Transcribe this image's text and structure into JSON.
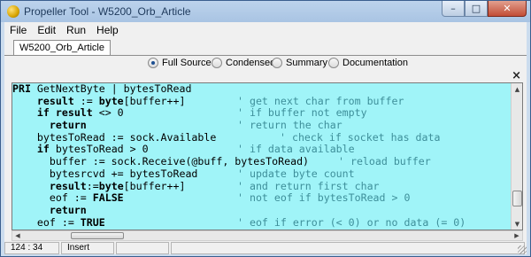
{
  "window": {
    "title": "Propeller Tool - W5200_Orb_Article",
    "minimize_glyph": "–",
    "maximize_glyph": "□",
    "close_glyph": "✕"
  },
  "menu": [
    "File",
    "Edit",
    "Run",
    "Help"
  ],
  "tabs": [
    {
      "label": "W5200_Orb_Article",
      "active": true
    }
  ],
  "view_options": {
    "full_source": "Full Source",
    "condensed": "Condensed",
    "summary": "Summary",
    "documentation": "Documentation",
    "selected": "Full Source"
  },
  "editor": {
    "background": "#a0f4f8",
    "comment_color": "#3e8f9a",
    "lines": [
      {
        "code": "PRI GetNextByte | bytesToRead",
        "comment": ""
      },
      {
        "code": "    result := byte[buffer++]",
        "comment": "' get next char from buffer"
      },
      {
        "code": "    if result <> 0",
        "comment": "' if buffer not empty"
      },
      {
        "code": "      return",
        "comment": "' return the char"
      },
      {
        "code": "    bytesToRead := sock.Available",
        "comment": "' check if socket has data"
      },
      {
        "code": "    if bytesToRead > 0",
        "comment": "' if data available"
      },
      {
        "code": "      buffer := sock.Receive(@buff, bytesToRead)",
        "comment": "' reload buffer"
      },
      {
        "code": "      bytesrcvd += bytesToRead",
        "comment": "' update byte count"
      },
      {
        "code": "      result:=byte[buffer++]",
        "comment": "' and return first char"
      },
      {
        "code": "      eof := FALSE",
        "comment": "' not eof if bytesToRead > 0"
      },
      {
        "code": "      return",
        "comment": ""
      },
      {
        "code": "    eof := TRUE",
        "comment": "' eof if error (< 0) or no data (= 0)"
      },
      {
        "code": "    return",
        "comment": ""
      }
    ]
  },
  "status": {
    "cursor": "124 : 34",
    "mode": "Insert"
  }
}
